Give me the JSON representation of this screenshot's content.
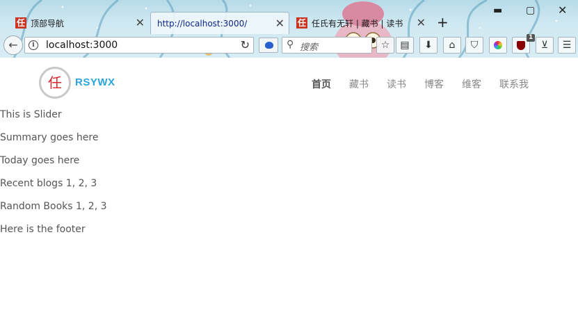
{
  "browser": {
    "tabs": [
      {
        "label": "顶部导航",
        "favicon": "任",
        "active": false
      },
      {
        "label": "http://localhost:3000/",
        "favicon": "",
        "active": true
      },
      {
        "label": "任氏有无轩 | 藏书 | 读书",
        "favicon": "任",
        "active": false
      }
    ],
    "new_tab_label": "+",
    "address": "localhost:3000",
    "search_placeholder": "搜索",
    "extension_badge": "1"
  },
  "site": {
    "logo_char": "任",
    "brand": "RSYWX",
    "brand_color": "#2aa6dd",
    "nav": [
      {
        "label": "首页",
        "active": true
      },
      {
        "label": "藏书",
        "active": false
      },
      {
        "label": "读书",
        "active": false
      },
      {
        "label": "博客",
        "active": false
      },
      {
        "label": "维客",
        "active": false
      },
      {
        "label": "联系我",
        "active": false
      }
    ]
  },
  "content": {
    "slider": "This is Slider",
    "summary": "Summary goes here",
    "today": "Today goes here",
    "recent_blogs": "Recent blogs 1, 2, 3",
    "random_books": "Random Books 1, 2, 3",
    "footer": "Here is the footer"
  }
}
